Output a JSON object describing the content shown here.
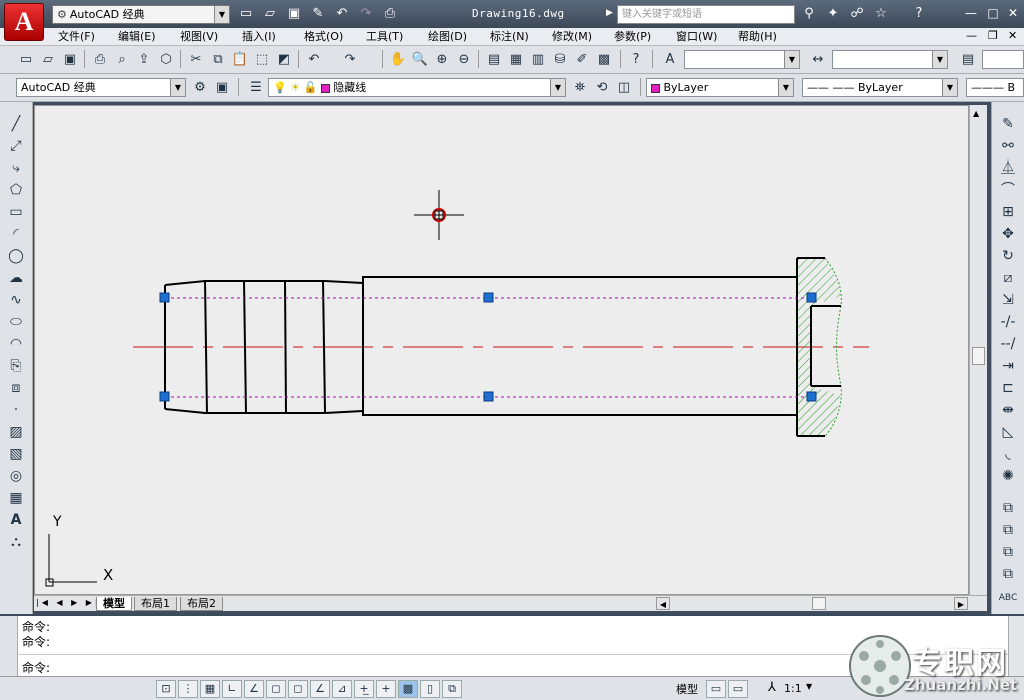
{
  "app": {
    "logo_letter": "A",
    "workspace": "AutoCAD 经典",
    "document_title": "Drawing16.dwg",
    "search_placeholder": "键入关键字或短语"
  },
  "menu": [
    "文件(F)",
    "编辑(E)",
    "视图(V)",
    "插入(I)",
    "格式(O)",
    "工具(T)",
    "绘图(D)",
    "标注(N)",
    "修改(M)",
    "参数(P)",
    "窗口(W)",
    "帮助(H)"
  ],
  "toolbar2": {
    "workspace": "AutoCAD 经典",
    "layer": "隐藏线",
    "color": "ByLayer",
    "linetype": "ByLayer",
    "lineweight_partial": "B"
  },
  "colors": {
    "layer_swatch": "#e020c0",
    "color_swatch": "#e020c0",
    "center_line": "#d01010",
    "hidden_line": "#c000c0",
    "grip": "#1f6fd0",
    "hatch": "#2a9a2a",
    "cursor_marker": "#cc0000"
  },
  "ucs": {
    "y_label": "Y",
    "x_label": "X"
  },
  "layout_tabs": [
    "模型",
    "布局1",
    "布局2"
  ],
  "command": {
    "line1": "命令:",
    "line2": "命令:",
    "prompt": "命令:"
  },
  "status": {
    "model_label": "模型",
    "scale": "1:1"
  },
  "watermark": {
    "brand": "专职网",
    "url": "Zhuanzhi.Net"
  }
}
